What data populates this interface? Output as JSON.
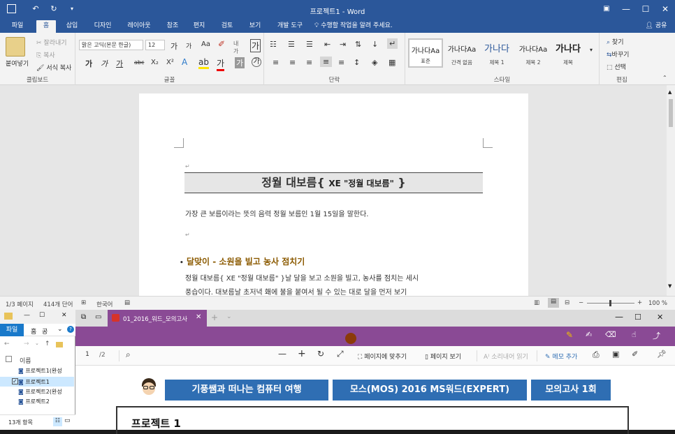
{
  "word": {
    "title": "프로젝트1 - Word",
    "tabs": [
      "파일",
      "홈",
      "삽입",
      "디자인",
      "레이아웃",
      "참조",
      "편지",
      "검토",
      "보기",
      "개발 도구"
    ],
    "tell_me": "수행할 작업을 알려 주세요.",
    "share": "공유",
    "clipboard": {
      "paste": "붙여넣기",
      "cut": "잘라내기",
      "copy": "복사",
      "format_painter": "서식 복사",
      "label": "클립보드"
    },
    "font": {
      "name": "맑은 고딕(본문 한글)",
      "size": "12",
      "label": "글꼴",
      "grow": "가",
      "shrink": "가",
      "aa": "Aa",
      "bold": "가",
      "italic": "가",
      "underline": "가",
      "strike": "abc",
      "sub": "X₂",
      "sup": "X²",
      "clear": "가"
    },
    "paragraph": {
      "label": "단락"
    },
    "styles": {
      "label": "스타일",
      "items": [
        {
          "preview": "가나다Aa",
          "name": "표준"
        },
        {
          "preview": "가나다Aa",
          "name": "간격 없음"
        },
        {
          "preview": "가나다",
          "name": "제목 1"
        },
        {
          "preview": "가나다Aa",
          "name": "제목 2"
        },
        {
          "preview": "가나다",
          "name": "제목"
        }
      ]
    },
    "editing": {
      "find": "찾기",
      "replace": "바꾸기",
      "select": "선택",
      "label": "편집"
    },
    "document": {
      "heading": "정월 대보름",
      "heading_field": "XE \"정월 대보름\"",
      "para1": "가장 큰 보름이라는 뜻의 음력 정월 보름인 1월 15일을 말한다.",
      "bullet_heading": "달맞이 - 소원을 빌고 농사 점치기",
      "body_line1": "정월 대보름{ XE \"정월 대보름\" }날 달을 보고 소원을 빌고, 농사를 점치는 세시",
      "body_line2": "풍습이다. 대보름날 초저녁 홰에 불을 붙여서 될 수 있는 대로 달을 먼저 보기"
    },
    "status": {
      "page": "1/3 페이지",
      "words": "414개 단어",
      "lang": "한국어",
      "zoom": "100 %"
    }
  },
  "explorer": {
    "tabs": [
      "파일",
      "홈",
      "공"
    ],
    "header": "이름",
    "files": [
      "프로젝트1(완성",
      "프로젝트1",
      "프로젝트2(완성",
      "프로젝트2"
    ],
    "count": "13개 항목"
  },
  "edge": {
    "tab_title": "01_2016_워드_모의고사",
    "page_num": "1",
    "page_total": "/2",
    "toolbar": {
      "fit": "페이지에 맞추기",
      "page_view": "페이지 보기",
      "read_aloud": "소리내어 읽기",
      "add_note": "메모 추가"
    },
    "pdf": {
      "banner1": "기풍쌤과 떠나는 컴퓨터 여행",
      "banner2": "모스(MOS) 2016 MS워드(EXPERT)",
      "banner3": "모의고사 1회",
      "project_title": "프로젝트 1"
    }
  },
  "colors": {
    "word_blue": "#2b579a",
    "edge_purple": "#8a4a95",
    "banner_blue": "#2f6eb3",
    "bullet_gold": "#8b5a00"
  }
}
